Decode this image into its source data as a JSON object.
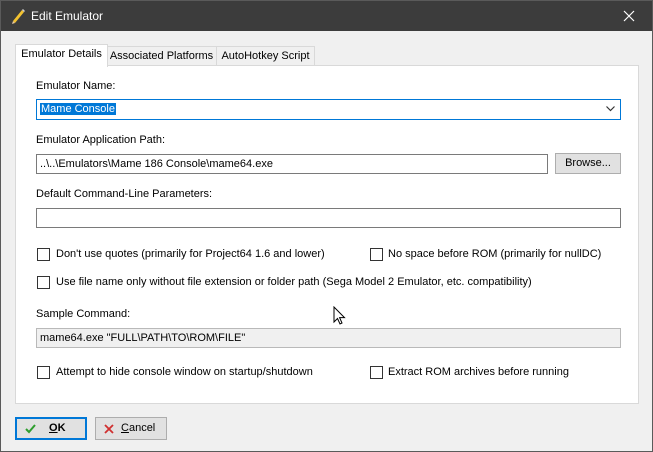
{
  "window": {
    "title": "Edit Emulator"
  },
  "tabs": [
    {
      "label": "Emulator Details"
    },
    {
      "label": "Associated Platforms"
    },
    {
      "label": "AutoHotkey Script"
    }
  ],
  "form": {
    "name_label": "Emulator Name:",
    "name_value": "Mame Console",
    "path_label": "Emulator Application Path:",
    "path_value": "..\\..\\Emulators\\Mame 186 Console\\mame64.exe",
    "browse_label": "Browse...",
    "params_label": "Default Command-Line Parameters:",
    "params_value": "",
    "sample_label": "Sample Command:",
    "sample_value": "mame64.exe \"FULL\\PATH\\TO\\ROM\\FILE\""
  },
  "options": {
    "no_quotes": {
      "label": "Don't use quotes (primarily for Project64 1.6 and lower)",
      "checked": false
    },
    "no_space": {
      "label": "No space before ROM (primarily for nullDC)",
      "checked": false
    },
    "filename_only": {
      "label": "Use file name only without file extension or folder path (Sega Model 2 Emulator, etc. compatibility)",
      "checked": false
    },
    "hide_console": {
      "label": "Attempt to hide console window on startup/shutdown",
      "checked": false
    },
    "extract_rom": {
      "label": "Extract ROM archives before running",
      "checked": false
    }
  },
  "buttons": {
    "ok": {
      "label": "OK",
      "accel": "O",
      "rest": "K"
    },
    "cancel": {
      "label": "Cancel",
      "accel": "C",
      "rest": "ancel"
    }
  },
  "colors": {
    "titlebar": "#3c3c3c",
    "accent": "#0078d7",
    "ok_check": "#2e9e2e",
    "cancel_x": "#d03030"
  }
}
